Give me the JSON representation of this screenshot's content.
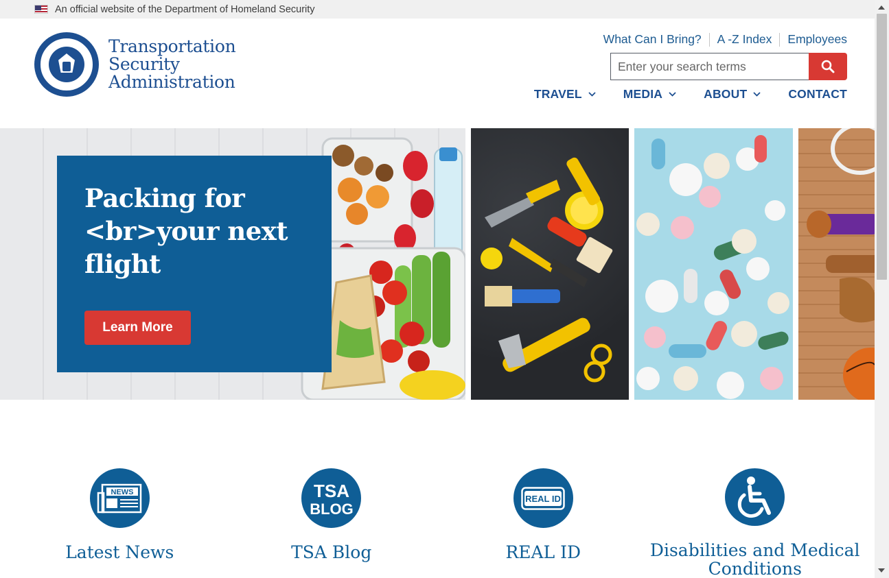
{
  "gov_banner": {
    "text": "An official website of the Department of Homeland Security",
    "flag_icon": "us-flag-icon"
  },
  "header": {
    "brand_lines": [
      "Transportation",
      "Security",
      "Administration"
    ],
    "utility_links": [
      "What Can I Bring?",
      "A -Z Index",
      "Employees"
    ],
    "search": {
      "placeholder": "Enter your search terms",
      "value": ""
    },
    "nav": [
      {
        "label": "TRAVEL",
        "dropdown": true
      },
      {
        "label": "MEDIA",
        "dropdown": true
      },
      {
        "label": "ABOUT",
        "dropdown": true
      },
      {
        "label": "CONTACT",
        "dropdown": false
      }
    ]
  },
  "hero": {
    "title": "Packing for <br>your next flight",
    "button": "Learn More"
  },
  "features": [
    {
      "label": "Latest News",
      "icon": "news-icon"
    },
    {
      "label": "TSA Blog",
      "icon": "tsa-blog-icon"
    },
    {
      "label": "REAL ID",
      "icon": "real-id-icon"
    },
    {
      "label": "Disabilities and Medical Conditions",
      "icon": "wheelchair-icon"
    }
  ],
  "colors": {
    "primary": "#0f5e96",
    "brand_text": "#1d4f91",
    "accent": "#d83933"
  }
}
